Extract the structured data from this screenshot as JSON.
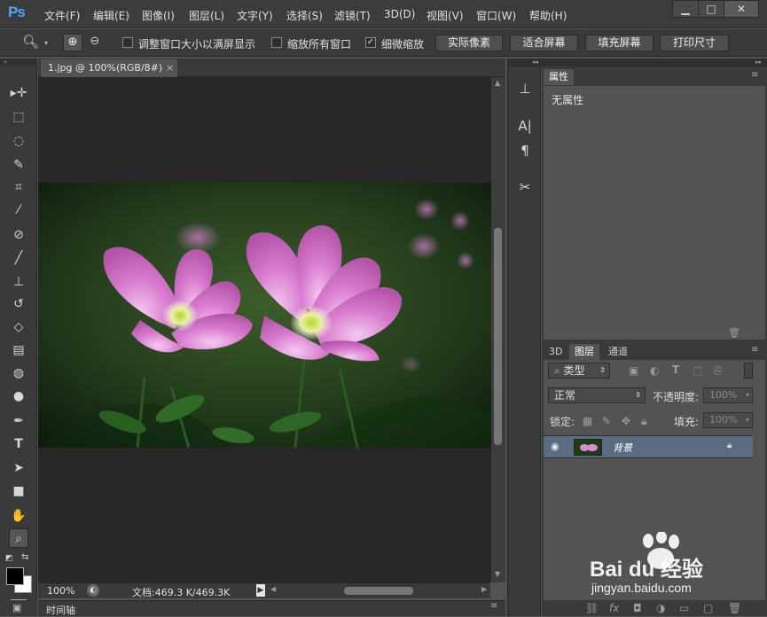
{
  "app": {
    "logo": "Ps"
  },
  "menu": [
    "文件(F)",
    "编辑(E)",
    "图像(I)",
    "图层(L)",
    "文字(Y)",
    "选择(S)",
    "滤镜(T)",
    "3D(D)",
    "视图(V)",
    "窗口(W)",
    "帮助(H)"
  ],
  "window_controls": {
    "minimize": "▁",
    "maximize": "□",
    "close": "✕"
  },
  "options": {
    "resize_windows": {
      "label": "调整窗口大小以满屏显示",
      "checked": false
    },
    "zoom_all": {
      "label": "缩放所有窗口",
      "checked": false
    },
    "scrubby_zoom": {
      "label": "细微缩放",
      "checked": true
    },
    "buttons": [
      "实际像素",
      "适合屏幕",
      "填充屏幕",
      "打印尺寸"
    ]
  },
  "document": {
    "tab_title": "1.jpg @ 100%(RGB/8#)",
    "tab_close": "×",
    "zoom": "100%",
    "doc_size": "文档:469.3 K/469.3K"
  },
  "timeline": {
    "label": "时间轴"
  },
  "properties": {
    "tab": "属性",
    "content": "无属性"
  },
  "layers": {
    "tabs": [
      "3D",
      "图层",
      "通道"
    ],
    "filter_kind": "类型",
    "blend_mode": "正常",
    "opacity_label": "不透明度:",
    "opacity_value": "100%",
    "lock_label": "锁定:",
    "fill_label": "填充:",
    "fill_value": "100%",
    "items": [
      {
        "name": "背景",
        "visible": true,
        "locked": true
      }
    ]
  },
  "watermark": {
    "brand": "Bai du 经验",
    "url": "jingyan.baidu.com"
  },
  "colors": {
    "ps_blue": "#4ea5ff",
    "selected_layer": "#5a6b82",
    "canvas_bg": "#282828"
  }
}
